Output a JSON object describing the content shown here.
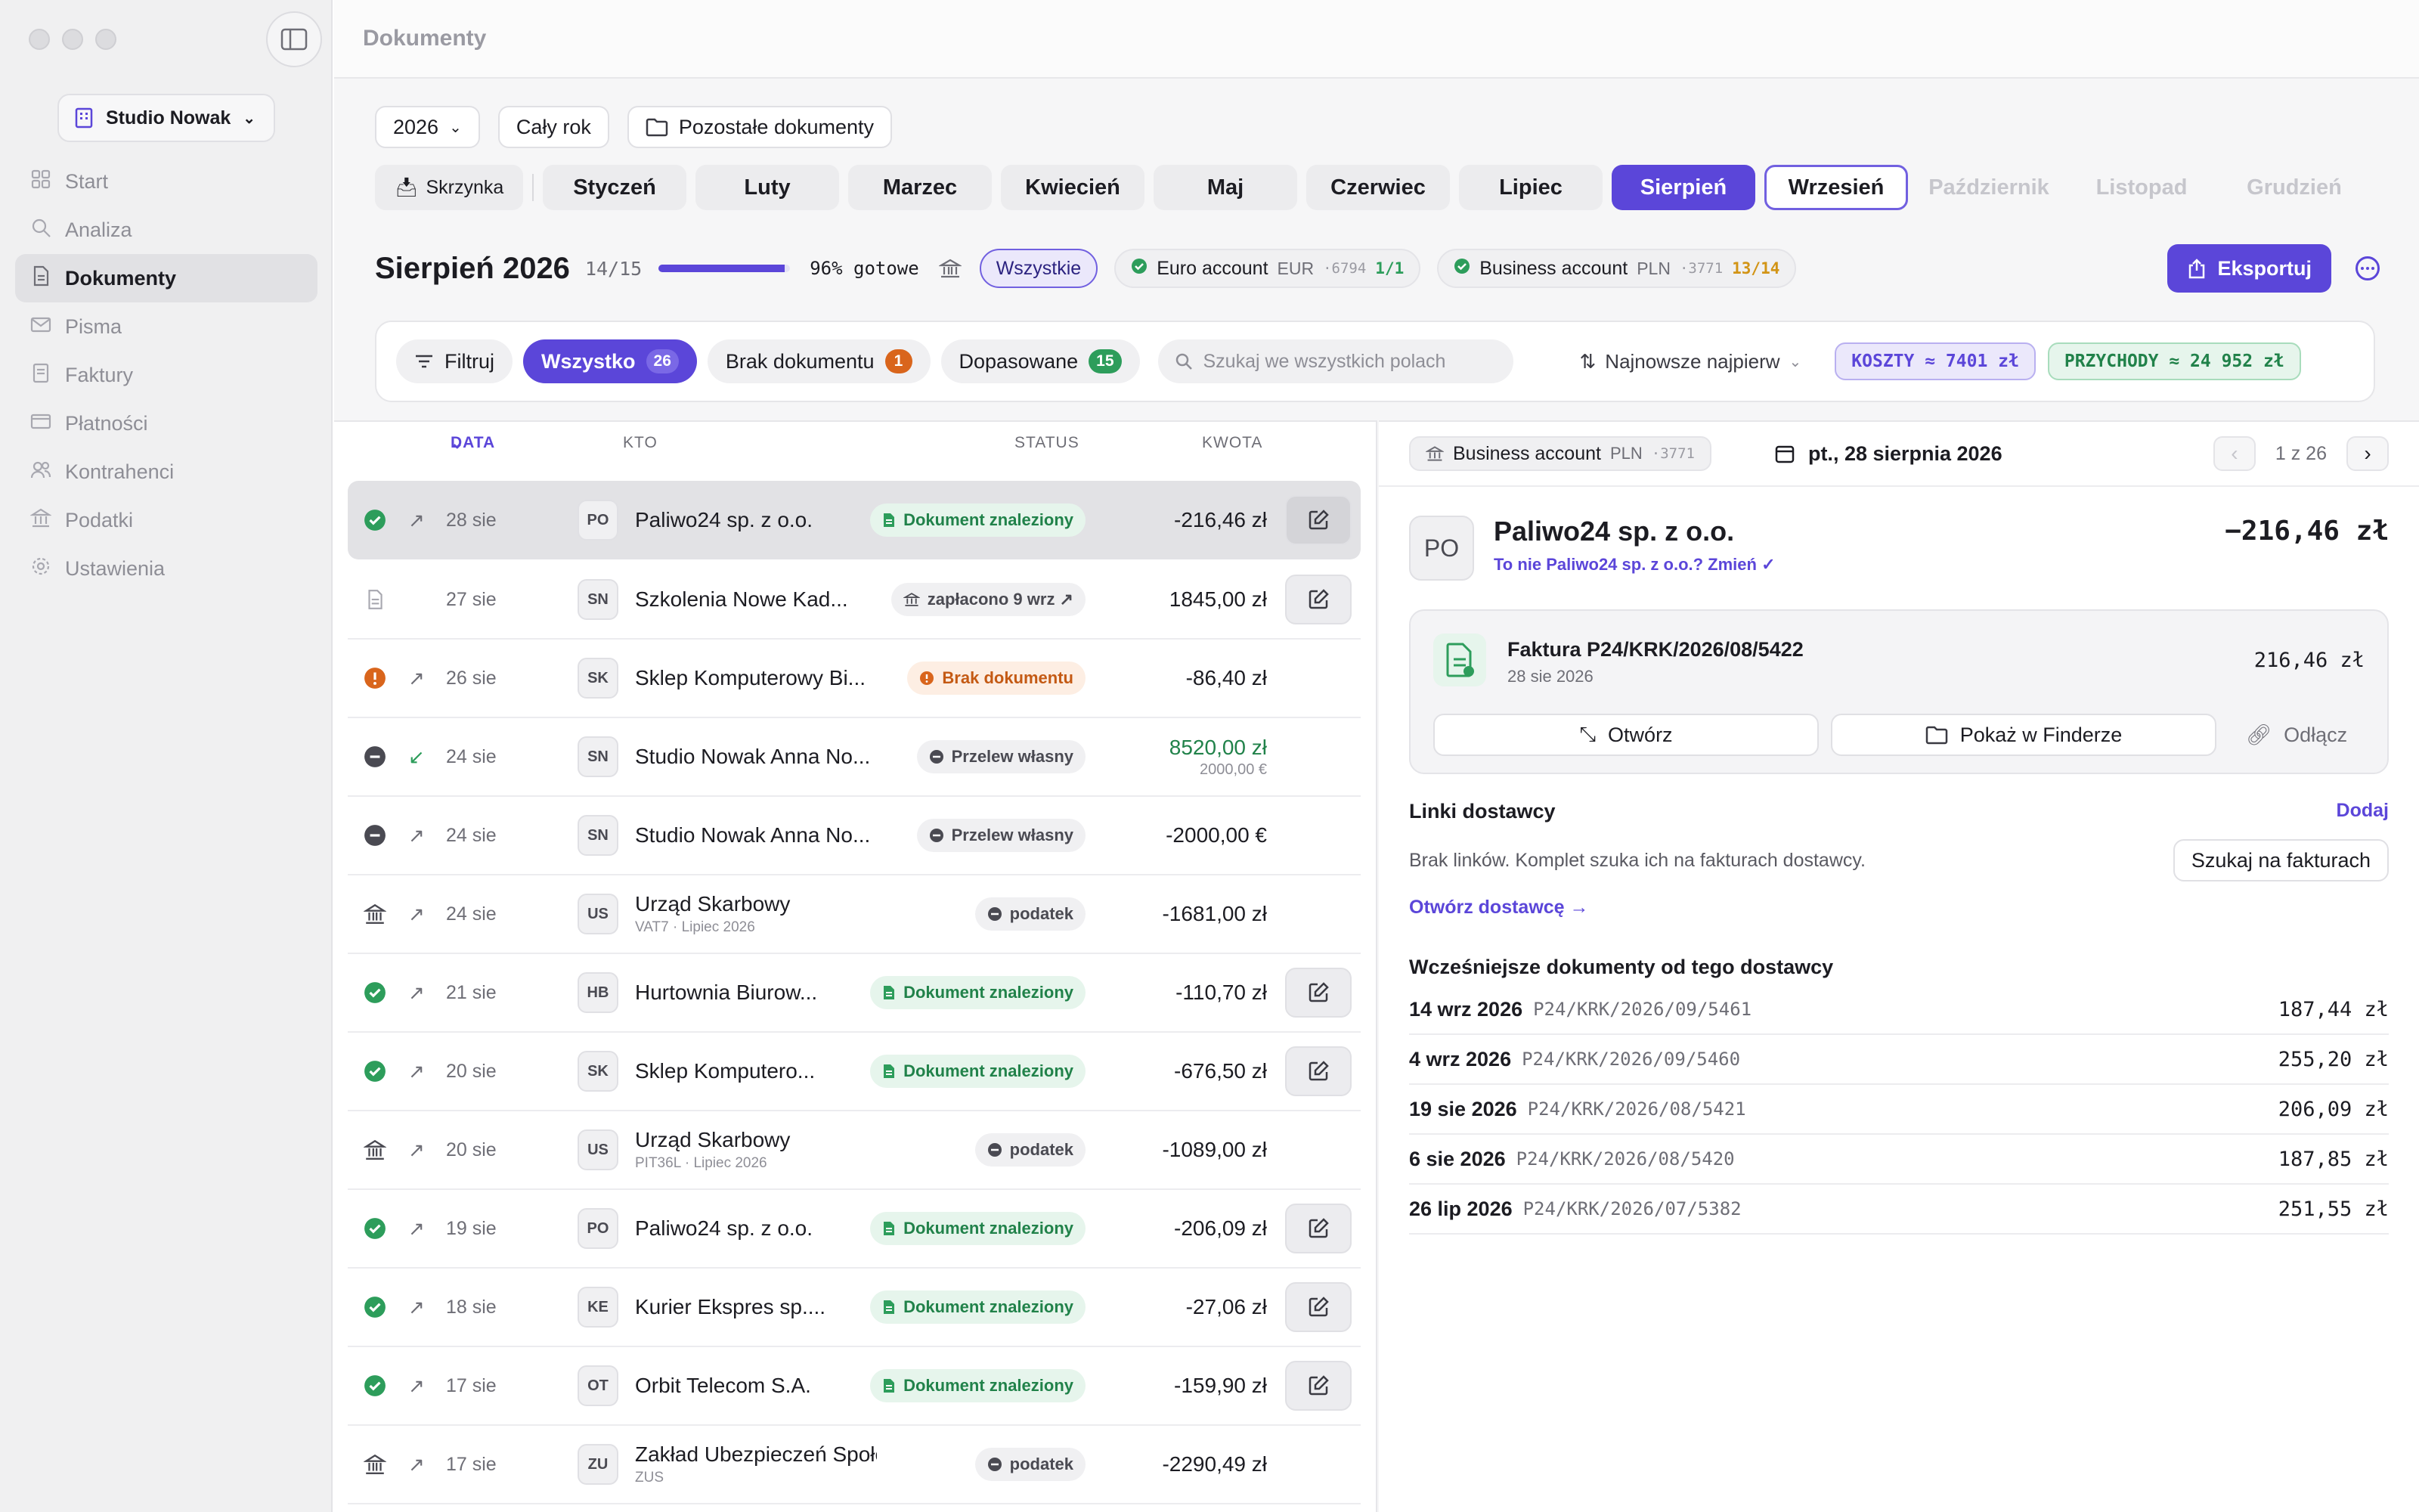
{
  "window": {
    "title": "Dokumenty"
  },
  "workspace": {
    "name": "Studio Nowak"
  },
  "sidebar": {
    "items": [
      {
        "label": "Start",
        "icon": "grid-icon",
        "active": false
      },
      {
        "label": "Analiza",
        "icon": "magnifier-icon",
        "active": false
      },
      {
        "label": "Dokumenty",
        "icon": "document-icon",
        "active": true
      },
      {
        "label": "Pisma",
        "icon": "envelope-icon",
        "active": false
      },
      {
        "label": "Faktury",
        "icon": "invoice-icon",
        "active": false
      },
      {
        "label": "Płatności",
        "icon": "card-icon",
        "active": false
      },
      {
        "label": "Kontrahenci",
        "icon": "people-icon",
        "active": false
      },
      {
        "label": "Podatki",
        "icon": "bank-icon",
        "active": false
      },
      {
        "label": "Ustawienia",
        "icon": "gear-icon",
        "active": false
      }
    ]
  },
  "toolbar": {
    "year": "2026",
    "period": "Cały rok",
    "other_docs": "Pozostałe dokumenty"
  },
  "months": {
    "inbox": "Skrzynka",
    "items": [
      "Styczeń",
      "Luty",
      "Marzec",
      "Kwiecień",
      "Maj",
      "Czerwiec",
      "Lipiec",
      "Sierpień",
      "Wrzesień",
      "Październik",
      "Listopad",
      "Grudzień"
    ],
    "active": "Sierpień",
    "current": "Wrzesień",
    "disabled": [
      "Październik",
      "Listopad",
      "Grudzień"
    ]
  },
  "summary": {
    "title": "Sierpień 2026",
    "ratio": "14/15",
    "progress": 0.96,
    "ready": "96% gotowe",
    "all_label": "Wszystkie",
    "accounts": [
      {
        "name": "Euro account",
        "currency": "EUR",
        "number": "·6794",
        "count": "1/1"
      },
      {
        "name": "Business account",
        "currency": "PLN",
        "number": "·3771",
        "count": "13/14"
      }
    ],
    "export": "Eksportuj"
  },
  "filters": {
    "filter": "Filtruj",
    "tabs": [
      {
        "label": "Wszystko",
        "count": "26"
      },
      {
        "label": "Brak dokumentu",
        "count": "1"
      },
      {
        "label": "Dopasowane",
        "count": "15"
      }
    ],
    "search_placeholder": "Szukaj we wszystkich polach",
    "sort": "Najnowsze najpierw",
    "costs": "KOSZTY ≈ 7401 zł",
    "income": "PRZYCHODY ≈ 24 952 zł"
  },
  "table": {
    "headers": {
      "date": "DATA",
      "who": "KTO",
      "status": "STATUS",
      "amount": "KWOTA"
    },
    "rows": [
      {
        "state": "ok",
        "dir": "↗",
        "date": "28 sie",
        "av": "PO",
        "name": "Paliwo24 sp. z o.o.",
        "sub": "",
        "status": "Dokument znaleziony",
        "stype": "found",
        "amount": "-216,46 zł",
        "amount_sub": "",
        "edit": true,
        "selected": true
      },
      {
        "state": "doc",
        "dir": "",
        "date": "27 sie",
        "av": "SN",
        "name": "Szkolenia Nowe Kad...",
        "sub": "",
        "status": "zapłacono 9 wrz ↗",
        "stype": "paid",
        "amount": "1845,00 zł",
        "amount_sub": "",
        "edit": true,
        "selected": false
      },
      {
        "state": "warn",
        "dir": "↗",
        "date": "26 sie",
        "av": "SK",
        "name": "Sklep Komputerowy Bi...",
        "sub": "",
        "status": "Brak dokumentu",
        "stype": "miss",
        "amount": "-86,40 zł",
        "amount_sub": "",
        "edit": false,
        "selected": false
      },
      {
        "state": "minus",
        "dir": "↙",
        "date": "24 sie",
        "av": "SN",
        "name": "Studio Nowak Anna No...",
        "sub": "",
        "status": "Przelew własny",
        "stype": "own",
        "amount": "8520,00 zł",
        "amount_sub": "2000,00 €",
        "edit": false,
        "selected": false
      },
      {
        "state": "minus",
        "dir": "↗",
        "date": "24 sie",
        "av": "SN",
        "name": "Studio Nowak Anna No...",
        "sub": "",
        "status": "Przelew własny",
        "stype": "own",
        "amount": "-2000,00 €",
        "amount_sub": "",
        "edit": false,
        "selected": false
      },
      {
        "state": "bank",
        "dir": "↗",
        "date": "24 sie",
        "av": "US",
        "name": "Urząd Skarbowy",
        "sub": "VAT7 · Lipiec 2026",
        "status": "podatek",
        "stype": "tax",
        "amount": "-1681,00 zł",
        "amount_sub": "",
        "edit": false,
        "selected": false
      },
      {
        "state": "ok",
        "dir": "↗",
        "date": "21 sie",
        "av": "HB",
        "name": "Hurtownia Biurow...",
        "sub": "",
        "status": "Dokument znaleziony",
        "stype": "found",
        "amount": "-110,70 zł",
        "amount_sub": "",
        "edit": true,
        "selected": false
      },
      {
        "state": "ok",
        "dir": "↗",
        "date": "20 sie",
        "av": "SK",
        "name": "Sklep Komputero...",
        "sub": "",
        "status": "Dokument znaleziony",
        "stype": "found",
        "amount": "-676,50 zł",
        "amount_sub": "",
        "edit": true,
        "selected": false
      },
      {
        "state": "bank",
        "dir": "↗",
        "date": "20 sie",
        "av": "US",
        "name": "Urząd Skarbowy",
        "sub": "PIT36L · Lipiec 2026",
        "status": "podatek",
        "stype": "tax",
        "amount": "-1089,00 zł",
        "amount_sub": "",
        "edit": false,
        "selected": false
      },
      {
        "state": "ok",
        "dir": "↗",
        "date": "19 sie",
        "av": "PO",
        "name": "Paliwo24 sp. z o.o.",
        "sub": "",
        "status": "Dokument znaleziony",
        "stype": "found",
        "amount": "-206,09 zł",
        "amount_sub": "",
        "edit": true,
        "selected": false
      },
      {
        "state": "ok",
        "dir": "↗",
        "date": "18 sie",
        "av": "KE",
        "name": "Kurier Ekspres sp....",
        "sub": "",
        "status": "Dokument znaleziony",
        "stype": "found",
        "amount": "-27,06 zł",
        "amount_sub": "",
        "edit": true,
        "selected": false
      },
      {
        "state": "ok",
        "dir": "↗",
        "date": "17 sie",
        "av": "OT",
        "name": "Orbit Telecom S.A.",
        "sub": "",
        "status": "Dokument znaleziony",
        "stype": "found",
        "amount": "-159,90 zł",
        "amount_sub": "",
        "edit": true,
        "selected": false
      },
      {
        "state": "bank",
        "dir": "↗",
        "date": "17 sie",
        "av": "ZU",
        "name": "Zakład Ubezpieczeń Społecz...",
        "sub": "ZUS",
        "status": "podatek",
        "stype": "tax",
        "amount": "-2290,49 zł",
        "amount_sub": "",
        "edit": false,
        "selected": false
      }
    ]
  },
  "detail": {
    "account": {
      "name": "Business account",
      "currency": "PLN",
      "number": "·3771"
    },
    "date": "pt., 28 sierpnia 2026",
    "pager": "1 z 26",
    "vendor": {
      "initials": "PO",
      "name": "Paliwo24 sp. z o.o.",
      "change": "To nie Paliwo24 sp. z o.o.? Zmień ✓",
      "amount": "−216,46 zł"
    },
    "invoice": {
      "title": "Faktura P24/KRK/2026/08/5422",
      "date": "28 sie 2026",
      "amount": "216,46 zł",
      "open": "Otwórz",
      "finder": "Pokaż w Finderze",
      "detach": "Odłącz"
    },
    "links": {
      "title": "Linki dostawcy",
      "add": "Dodaj",
      "none": "Brak linków. Komplet szuka ich na fakturach dostawcy.",
      "search": "Szukaj na fakturach",
      "open_vendor": "Otwórz dostawcę →"
    },
    "previous": {
      "title": "Wcześniejsze dokumenty od tego dostawcy",
      "items": [
        {
          "date": "14 wrz 2026",
          "number": "P24/KRK/2026/09/5461",
          "amount": "187,44 zł"
        },
        {
          "date": "4 wrz 2026",
          "number": "P24/KRK/2026/09/5460",
          "amount": "255,20 zł"
        },
        {
          "date": "19 sie 2026",
          "number": "P24/KRK/2026/08/5421",
          "amount": "206,09 zł"
        },
        {
          "date": "6 sie 2026",
          "number": "P24/KRK/2026/08/5420",
          "amount": "187,85 zł"
        },
        {
          "date": "26 lip 2026",
          "number": "P24/KRK/2026/07/5382",
          "amount": "251,55 zł"
        }
      ]
    }
  },
  "colors": {
    "accent": "#5b46d9",
    "success": "#2d9d5b",
    "warning": "#d9651c"
  }
}
